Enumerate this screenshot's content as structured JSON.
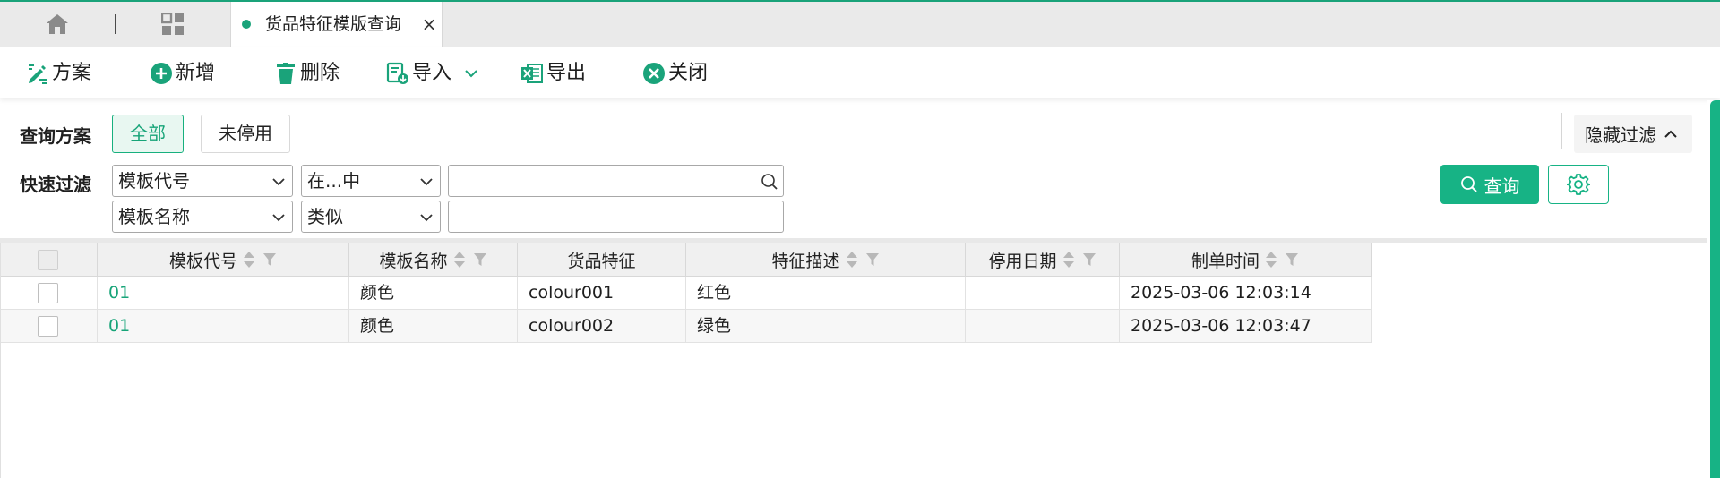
{
  "tabbar": {
    "active_tab_title": "货品特征模版查询",
    "close_glyph": "×"
  },
  "toolbar": {
    "scheme": "方案",
    "add": "新增",
    "delete": "删除",
    "import": "导入",
    "export": "导出",
    "close": "关闭"
  },
  "filter": {
    "query_scheme_label": "查询方案",
    "scheme_all": "全部",
    "scheme_not_disabled": "未停用",
    "hide_filter": "隐藏过滤",
    "quick_filter_label": "快速过滤",
    "rows": [
      {
        "field": "模板代号",
        "operator": "在...中",
        "value": ""
      },
      {
        "field": "模板名称",
        "operator": "类似",
        "value": ""
      }
    ],
    "query_button": "查询"
  },
  "grid": {
    "columns": [
      "模板代号",
      "模板名称",
      "货品特征",
      "特征描述",
      "停用日期",
      "制单时间"
    ],
    "rows": [
      {
        "code": "01",
        "name": "颜色",
        "feature": "colour001",
        "desc": "红色",
        "disabled_date": "",
        "created": "2025-03-06 12:03:14"
      },
      {
        "code": "01",
        "name": "颜色",
        "feature": "colour002",
        "desc": "绿色",
        "disabled_date": "",
        "created": "2025-03-06 12:03:47"
      }
    ]
  },
  "colors": {
    "accent": "#17b385",
    "link": "#17a478",
    "delete_icon": "#1aa37a"
  },
  "icons": {
    "home": "home-icon",
    "apps": "apps-grid-icon",
    "scheme": "scheme-edit-icon",
    "add": "plus-circle-icon",
    "delete": "trash-icon",
    "import": "import-icon",
    "export": "excel-export-icon",
    "close": "close-circle-icon",
    "search": "search-icon",
    "settings": "gear-icon"
  }
}
